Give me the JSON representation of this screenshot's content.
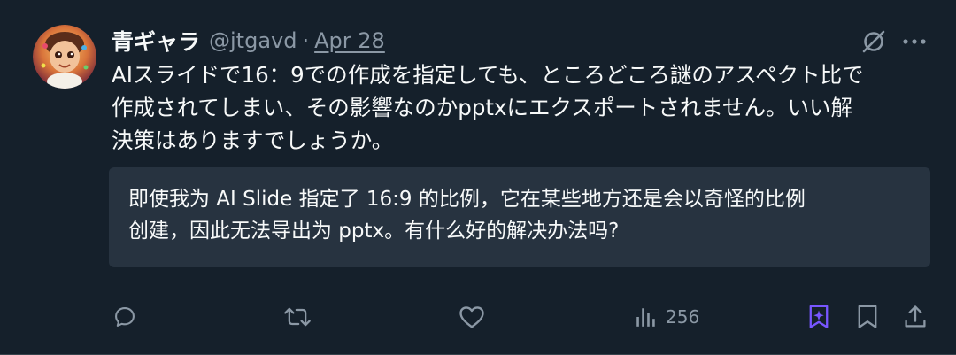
{
  "tweet": {
    "author": {
      "display_name": "青ギャラ",
      "handle": "@jtgavd",
      "avatar": "avatar-illustration"
    },
    "separator": "·",
    "date": "Apr 28",
    "text_lines": [
      "AIスライドで16：9での作成を指定しても、ところどころ謎のアスペクト比で",
      "作成されてしまい、その影響なのかpptxにエクスポートされません。いい解",
      "決策はありますでしょうか。"
    ],
    "translation_lines": [
      "即使我为 AI Slide 指定了 16:9 的比例，它在某些地方还是会以奇怪的比例",
      "创建，因此无法导出为 pptx。有什么好的解决办法吗?"
    ],
    "actions": {
      "reply_icon": "reply-icon",
      "retweet_icon": "retweet-icon",
      "like_icon": "like-icon",
      "views_icon": "views-icon",
      "views_count": "256",
      "grok_icon": "grok-icon",
      "bookmark_icon": "bookmark-icon",
      "share_icon": "share-icon"
    }
  },
  "colors": {
    "background": "#15202b",
    "text": "#f7f9f9",
    "secondary": "#8b98a5",
    "translation_bg": "#273340",
    "grok_accent": "#7856ff"
  }
}
